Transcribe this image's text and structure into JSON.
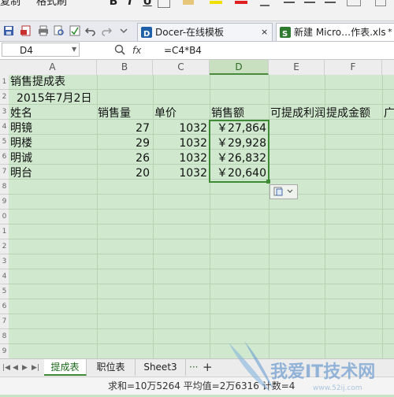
{
  "ribbon": {
    "copy": "复制",
    "format_painter": "格式刷",
    "bold": "B",
    "italic": "I",
    "underline": "U"
  },
  "tabs": [
    {
      "label": "Docer-在线模板",
      "close": "×"
    },
    {
      "label": "新建 Micro…作表.xls",
      "close": "*"
    }
  ],
  "formula_bar": {
    "name_box": "D4",
    "fx": "fx",
    "formula": "=C4*B4"
  },
  "columns": [
    "A",
    "B",
    "C",
    "D",
    "E",
    "F"
  ],
  "rows": [
    "1",
    "2",
    "3",
    "4",
    "5",
    "6",
    "7",
    "8",
    "9",
    "0",
    "1",
    "2",
    "3",
    "4",
    "5",
    "6",
    "7",
    "8",
    "9"
  ],
  "sheet": {
    "title": "销售提成表",
    "date": "2015年7月2日",
    "headers": [
      "姓名",
      "销售量",
      "单价",
      "销售额",
      "可提成利润",
      "提成金额",
      "广"
    ],
    "records": [
      {
        "name": "明镜",
        "qty": "27",
        "price": "1032",
        "sales": "￥27,864"
      },
      {
        "name": "明楼",
        "qty": "29",
        "price": "1032",
        "sales": "￥29,928"
      },
      {
        "name": "明诚",
        "qty": "26",
        "price": "1032",
        "sales": "￥26,832"
      },
      {
        "name": "明台",
        "qty": "20",
        "price": "1032",
        "sales": "￥20,640"
      }
    ]
  },
  "sheet_tabs": [
    "提成表",
    "职位表",
    "Sheet3"
  ],
  "sheet_tabs_more": "···",
  "sheet_tabs_add": "+",
  "status": "求和=10万5264   平均值=2万6316   计数=4",
  "watermark": {
    "text": "我爱IT技术网",
    "sub": "www.52ij.com"
  },
  "colors": {
    "accent": "#3f8a35",
    "grid_bg": "#cfe8ce"
  }
}
